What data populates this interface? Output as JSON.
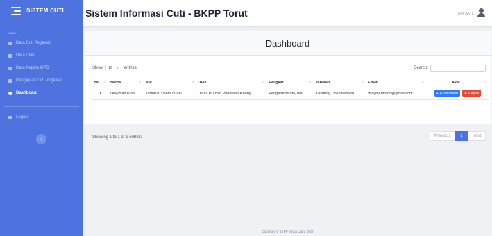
{
  "brand": {
    "name": "SISTEM CUTI"
  },
  "sidebar": {
    "heading": "ADMIN",
    "items": [
      {
        "label": "Data Cuti Pegawai",
        "icon": "table-icon"
      },
      {
        "label": "Data User",
        "icon": "users-icon"
      },
      {
        "label": "Data Kepala OPD",
        "icon": "user-tie-icon"
      },
      {
        "label": "Pengajuan Cuti Pegawai",
        "icon": "list-icon"
      },
      {
        "label": "Dashboard",
        "icon": "dashboard-icon",
        "active": true
      }
    ],
    "logout": "Logout",
    "toggle_glyph": "‹"
  },
  "topbar": {
    "title_main": "Sistem Informasi Cuti",
    "title_suffix": "- BKPP Torut",
    "user": "Rey Ary T."
  },
  "page": {
    "title": "Dashboard"
  },
  "table_controls": {
    "show_label": "Show",
    "entries_value": "10",
    "entries_label": "entries",
    "search_label": "Search:"
  },
  "table": {
    "columns": [
      "No",
      "Nama",
      "NIP",
      "OPD",
      "Pangkat",
      "Jabatan",
      "Email",
      "Aksi"
    ],
    "rows": [
      {
        "no": "1",
        "nama": "Drayman Pulo",
        "nip": "199001031995031001",
        "opd": "Dinas PU dan Penataan Ruang",
        "pangkat": "Pengatur Muda, II/a",
        "jabatan": "Kasubag Dokumentasi",
        "email": "draymantranc@gmail.com",
        "actions": [
          "Konfirmasi",
          "Hapus"
        ]
      }
    ]
  },
  "table_footer": {
    "info_prefix": "Showing",
    "info_from": "1",
    "info_to": "1",
    "info_total": "1",
    "info_to_word": "to",
    "info_of_word": "of",
    "info_suffix": "entries",
    "prev": "Previous",
    "current_page": "1",
    "next": "Next"
  },
  "footer": {
    "copyright": "Copyright © BKPP Toraja Utara 2022"
  },
  "colors": {
    "sidebar": "#4e73df",
    "confirm": "#2e7df7",
    "delete": "#e74a3b"
  }
}
